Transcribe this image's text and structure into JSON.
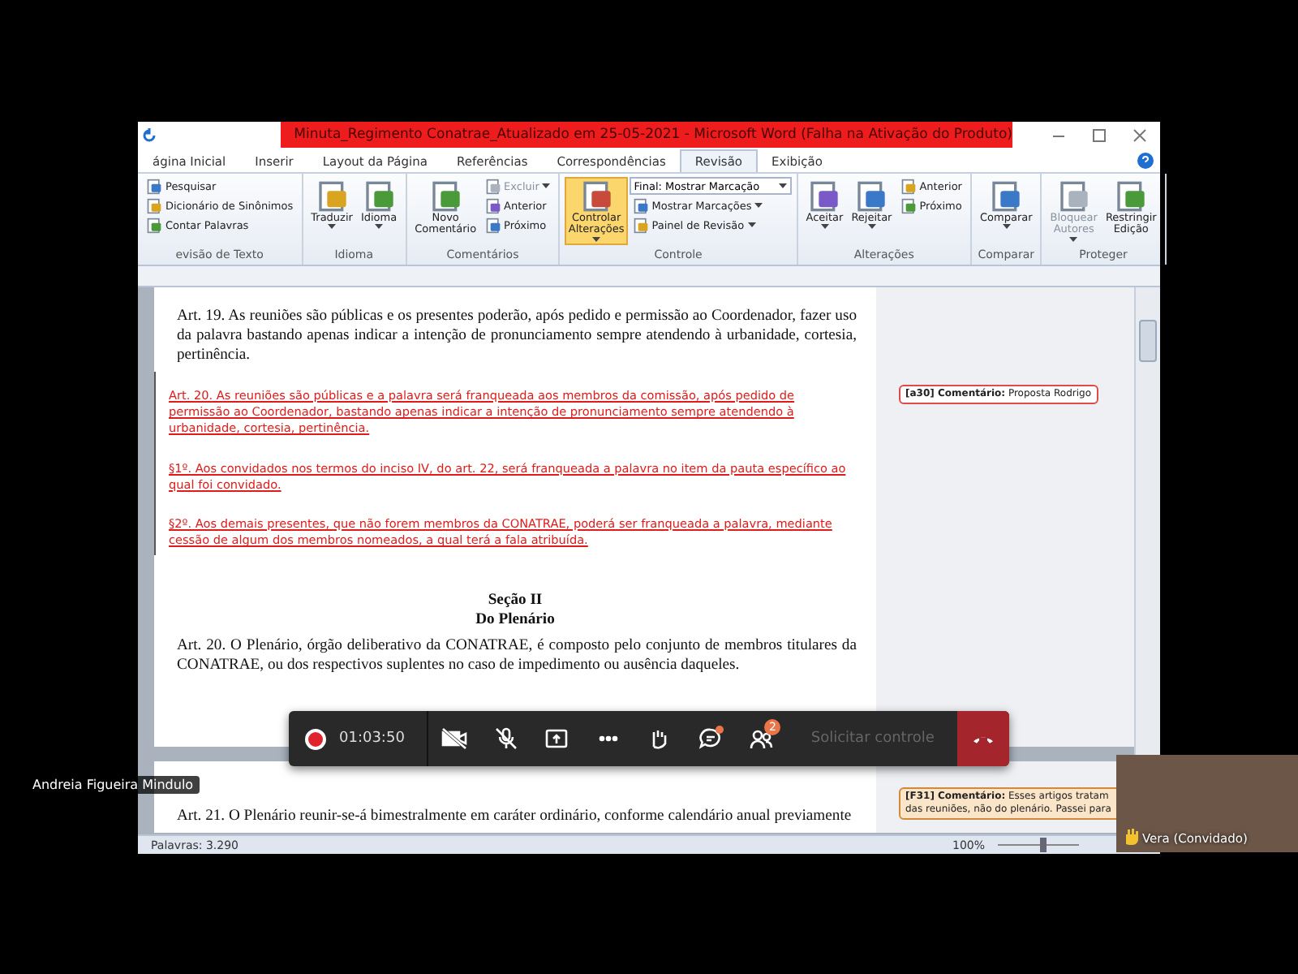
{
  "window": {
    "title": "Minuta_Regimento Conatrae_Atualizado em 25-05-2021  -  Microsoft Word (Falha na Ativação do Produto)"
  },
  "tabs": [
    {
      "label": "ágina Inicial",
      "selected": false
    },
    {
      "label": "Inserir",
      "selected": false
    },
    {
      "label": "Layout da Página",
      "selected": false
    },
    {
      "label": "Referências",
      "selected": false
    },
    {
      "label": "Correspondências",
      "selected": false
    },
    {
      "label": "Revisão",
      "selected": true
    },
    {
      "label": "Exibição",
      "selected": false
    }
  ],
  "ribbon": {
    "groups": [
      {
        "label": "evisão de Texto",
        "items": [
          {
            "kind": "small",
            "label": "Pesquisar",
            "dropdown": false,
            "disabled": false,
            "selected": false
          },
          {
            "kind": "small",
            "label": "Dicionário de Sinônimos",
            "dropdown": false,
            "disabled": false,
            "selected": false
          },
          {
            "kind": "small",
            "label": "Contar Palavras",
            "dropdown": false,
            "disabled": false,
            "selected": false
          }
        ]
      },
      {
        "label": "Idioma",
        "items": [
          {
            "kind": "large",
            "label": "Traduzir",
            "dropdown": true,
            "disabled": false,
            "selected": false
          },
          {
            "kind": "large",
            "label": "Idioma",
            "dropdown": true,
            "disabled": false,
            "selected": false
          }
        ]
      },
      {
        "label": "Comentários",
        "items": [
          {
            "kind": "large",
            "label": "Novo Comentário",
            "dropdown": false,
            "disabled": false,
            "selected": false
          },
          {
            "kind": "small",
            "label": "Excluir",
            "dropdown": true,
            "disabled": true,
            "selected": false
          },
          {
            "kind": "small",
            "label": "Anterior",
            "dropdown": false,
            "disabled": false,
            "selected": false
          },
          {
            "kind": "small",
            "label": "Próximo",
            "dropdown": false,
            "disabled": false,
            "selected": false
          }
        ]
      },
      {
        "label": "Controle",
        "items": [
          {
            "kind": "large",
            "label": "Controlar Alterações",
            "dropdown": true,
            "disabled": false,
            "selected": true
          },
          {
            "kind": "select",
            "label": "Final: Mostrar Marcação",
            "dropdown": true,
            "disabled": false,
            "selected": false
          },
          {
            "kind": "small",
            "label": "Mostrar Marcações",
            "dropdown": true,
            "disabled": false,
            "selected": false
          },
          {
            "kind": "small",
            "label": "Painel de Revisão",
            "dropdown": true,
            "disabled": false,
            "selected": false
          }
        ]
      },
      {
        "label": "Alterações",
        "items": [
          {
            "kind": "large",
            "label": "Aceitar",
            "dropdown": true,
            "disabled": false,
            "selected": false
          },
          {
            "kind": "large",
            "label": "Rejeitar",
            "dropdown": true,
            "disabled": false,
            "selected": false
          },
          {
            "kind": "small",
            "label": "Anterior",
            "dropdown": false,
            "disabled": false,
            "selected": false
          },
          {
            "kind": "small",
            "label": "Próximo",
            "dropdown": false,
            "disabled": false,
            "selected": false
          }
        ]
      },
      {
        "label": "Comparar",
        "items": [
          {
            "kind": "large",
            "label": "Comparar",
            "dropdown": true,
            "disabled": false,
            "selected": false
          }
        ]
      },
      {
        "label": "Proteger",
        "items": [
          {
            "kind": "large",
            "label": "Bloquear Autores",
            "dropdown": true,
            "disabled": true,
            "selected": false
          },
          {
            "kind": "large",
            "label": "Restringir Edição",
            "dropdown": false,
            "disabled": false,
            "selected": false
          }
        ]
      }
    ]
  },
  "document": {
    "pages": [
      {
        "paragraphs": [
          {
            "kind": "normal",
            "text": "Art. 19. As reuniões são públicas e os presentes poderão, após pedido e permissão ao Coordenador, fazer uso da palavra bastando apenas indicar a intenção de pronunciamento sempre atendendo à urbanidade, cortesia, pertinência."
          },
          {
            "kind": "inserted",
            "text": "Art. 20. As reuniões são públicas e a palavra será franqueada aos membros da comissão, após pedido de permissão ao Coordenador, bastando apenas indicar a intenção de pronunciamento sempre atendendo à urbanidade, cortesia, pertinência.",
            "comment": "**[a30] Comentário:** Proposta Rodrigo"
          },
          {
            "kind": "inserted",
            "text": "§1º. Aos convidados nos termos do inciso IV, do art. 22, será franqueada a palavra no item da pauta específico ao qual foi convidado."
          },
          {
            "kind": "inserted",
            "text": "§2º. Aos demais presentes, que não forem membros da CONATRAE, poderá ser franqueada a palavra, mediante cessão de algum dos membros nomeados, a qual terá a fala atribuída."
          },
          {
            "kind": "heading",
            "text": "Seção II"
          },
          {
            "kind": "heading",
            "text": "Do Plenário"
          },
          {
            "kind": "normal",
            "text": "Art. 20. O Plenário, órgão deliberativo da CONATRAE, é composto pelo conjunto de membros titulares da CONATRAE, ou dos respectivos suplentes no caso de impedimento ou ausência daqueles."
          }
        ]
      },
      {
        "paragraphs": [
          {
            "kind": "normal",
            "text": "Art. 21. O Plenário reunir-se-á bimestralmente em caráter ordinário, conforme calendário anual previamente",
            "comment": "**[F31] Comentário:** Esses artigos tratam das reuniões, não do plenário. Passei para"
          }
        ]
      }
    ]
  },
  "status_bar": {
    "words": "Palavras: 3.290",
    "zoom": "100%",
    "zoom_slider": {
      "level": 0.55
    }
  },
  "call": {
    "controls": [
      {
        "kind": "record",
        "label": "01:03:50"
      },
      {
        "kind": "camera"
      },
      {
        "kind": "mic"
      },
      {
        "kind": "share"
      },
      {
        "kind": "more"
      },
      {
        "kind": "hand"
      },
      {
        "kind": "chat",
        "dot": true
      },
      {
        "kind": "people",
        "badge": "2"
      },
      {
        "kind": "request",
        "label": "Solicitar controle",
        "disabled": true
      },
      {
        "kind": "hangup"
      }
    ],
    "presenter": "Andreia Figueira Mindulo",
    "participant": {
      "name": "Vera (Convidado)",
      "hand_raised": true
    }
  }
}
